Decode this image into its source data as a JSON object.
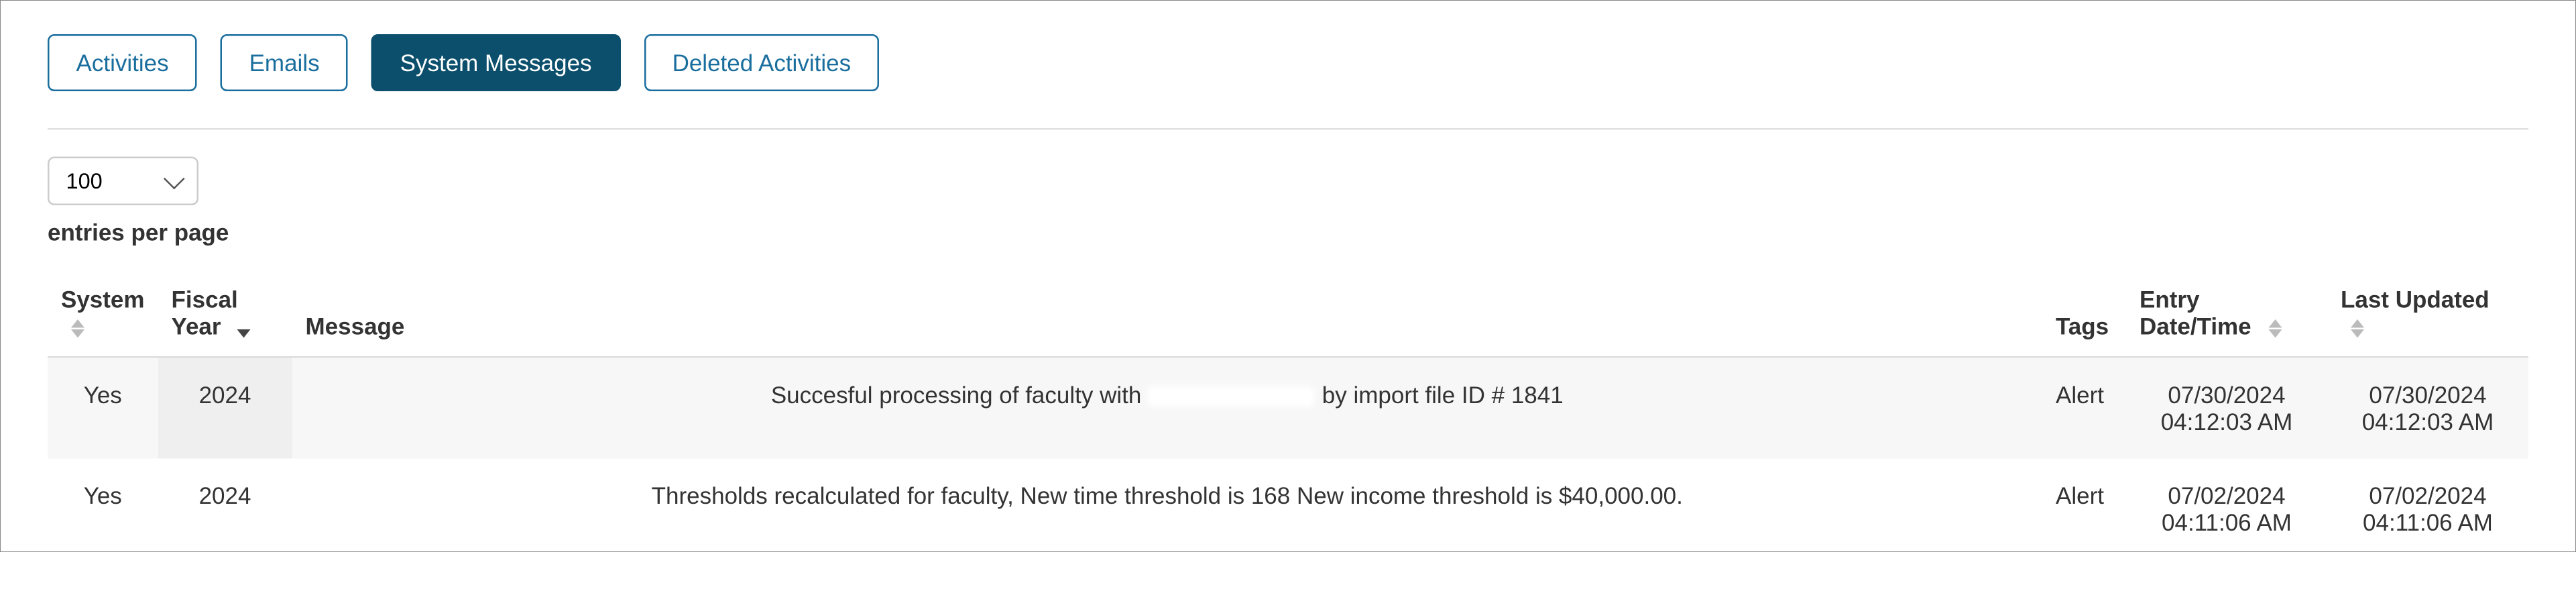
{
  "tabs": {
    "activities": "Activities",
    "emails": "Emails",
    "systemMessages": "System Messages",
    "deletedActivities": "Deleted Activities"
  },
  "pager": {
    "value": "100",
    "label": "entries per page"
  },
  "columns": {
    "system": "System",
    "fiscalYear": "Fiscal Year",
    "message": "Message",
    "tags": "Tags",
    "entryDate": "Entry Date/Time",
    "lastUpdated": "Last Updated"
  },
  "rows": [
    {
      "system": "Yes",
      "fy": "2024",
      "msg_a": "Succesful processing of faculty with ",
      "msg_b": " by import file ID # 1841",
      "tags": "Alert",
      "entry": "07/30/2024 04:12:03 AM",
      "updated": "07/30/2024 04:12:03 AM"
    },
    {
      "system": "Yes",
      "fy": "2024",
      "msg": "Thresholds recalculated for faculty, New time threshold is 168 New income threshold is $40,000.00.",
      "tags": "Alert",
      "entry": "07/02/2024 04:11:06 AM",
      "updated": "07/02/2024 04:11:06 AM"
    }
  ]
}
